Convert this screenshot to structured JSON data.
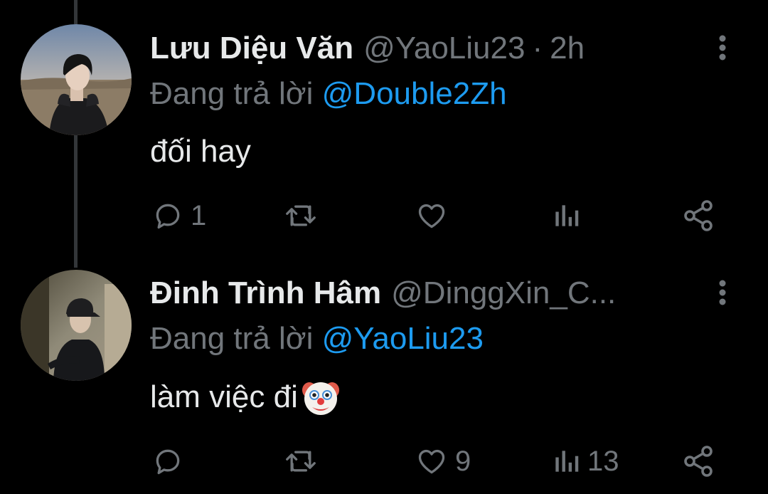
{
  "tweets": [
    {
      "name": "Lưu Diệu Văn",
      "handle": "@YaoLiu23",
      "separator": "·",
      "time": "2h",
      "reply_prefix": "Đang trả lời",
      "reply_to": "@Double2Zh",
      "text": "đối hay",
      "reply_count": "1",
      "retweet_count": "",
      "like_count": "",
      "view_count": ""
    },
    {
      "name": "Đinh Trình Hâm",
      "handle": "@DinggXin_C...",
      "reply_prefix": "Đang trả lời",
      "reply_to": "@YaoLiu23",
      "text": "làm việc đi",
      "emoji": "clown-face",
      "reply_count": "",
      "retweet_count": "",
      "like_count": "9",
      "view_count": "13"
    }
  ],
  "colors": {
    "background": "#000000",
    "primary_text": "#e7e9ea",
    "secondary_text": "#71767b",
    "mention": "#1d9bf0",
    "thread_line": "#333639"
  }
}
